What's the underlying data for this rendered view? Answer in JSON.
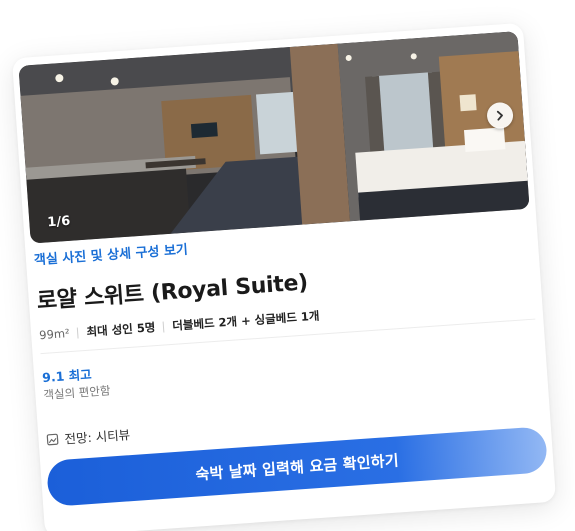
{
  "photo": {
    "counter": "1/6",
    "icons": {
      "next": "chevron-right-icon"
    }
  },
  "photo_link": "객실 사진 및 상세 구성 보기",
  "room": {
    "title": "로얄 스위트 (Royal Suite)",
    "area": "99m²",
    "capacity": "최대 성인 5명",
    "beds": "더블베드 2개 + 싱글베드 1개"
  },
  "rating": {
    "score_label": "9.1 최고",
    "description": "객실의 편안함"
  },
  "view": {
    "icon": "view-icon",
    "label": "전망: 시티뷰"
  },
  "cta": {
    "label": "숙박 날짜 입력해 요금 확인하기"
  },
  "colors": {
    "accent": "#1a6fd6",
    "button": "#1b5fd9"
  }
}
